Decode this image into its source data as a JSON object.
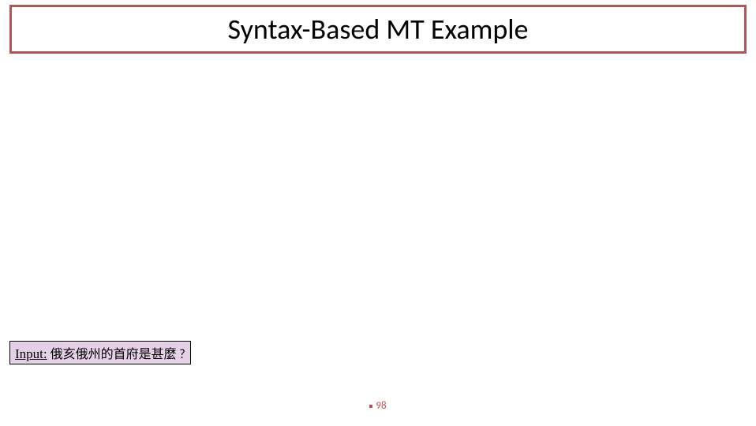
{
  "title": "Syntax-Based MT Example",
  "input": {
    "label": "Input:",
    "text": "俄亥俄州的首府是甚麼 ?"
  },
  "footer": {
    "page_number": "98"
  },
  "colors": {
    "accent": "#a85a5a",
    "footer": "#c0504d",
    "input_bg": "#e5d0e8"
  }
}
